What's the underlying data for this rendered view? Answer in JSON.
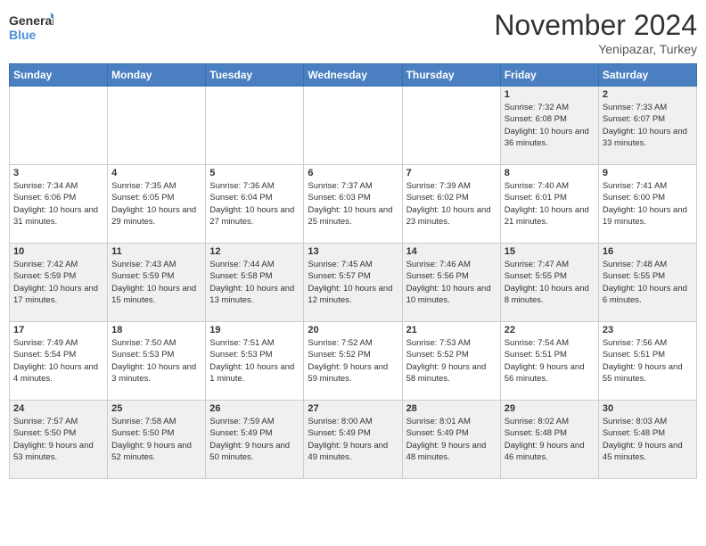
{
  "header": {
    "logo_line1": "General",
    "logo_line2": "Blue",
    "month": "November 2024",
    "location": "Yenipazar, Turkey"
  },
  "weekdays": [
    "Sunday",
    "Monday",
    "Tuesday",
    "Wednesday",
    "Thursday",
    "Friday",
    "Saturday"
  ],
  "weeks": [
    [
      {
        "day": "",
        "text": ""
      },
      {
        "day": "",
        "text": ""
      },
      {
        "day": "",
        "text": ""
      },
      {
        "day": "",
        "text": ""
      },
      {
        "day": "",
        "text": ""
      },
      {
        "day": "1",
        "text": "Sunrise: 7:32 AM\nSunset: 6:08 PM\nDaylight: 10 hours and 36 minutes."
      },
      {
        "day": "2",
        "text": "Sunrise: 7:33 AM\nSunset: 6:07 PM\nDaylight: 10 hours and 33 minutes."
      }
    ],
    [
      {
        "day": "3",
        "text": "Sunrise: 7:34 AM\nSunset: 6:06 PM\nDaylight: 10 hours and 31 minutes."
      },
      {
        "day": "4",
        "text": "Sunrise: 7:35 AM\nSunset: 6:05 PM\nDaylight: 10 hours and 29 minutes."
      },
      {
        "day": "5",
        "text": "Sunrise: 7:36 AM\nSunset: 6:04 PM\nDaylight: 10 hours and 27 minutes."
      },
      {
        "day": "6",
        "text": "Sunrise: 7:37 AM\nSunset: 6:03 PM\nDaylight: 10 hours and 25 minutes."
      },
      {
        "day": "7",
        "text": "Sunrise: 7:39 AM\nSunset: 6:02 PM\nDaylight: 10 hours and 23 minutes."
      },
      {
        "day": "8",
        "text": "Sunrise: 7:40 AM\nSunset: 6:01 PM\nDaylight: 10 hours and 21 minutes."
      },
      {
        "day": "9",
        "text": "Sunrise: 7:41 AM\nSunset: 6:00 PM\nDaylight: 10 hours and 19 minutes."
      }
    ],
    [
      {
        "day": "10",
        "text": "Sunrise: 7:42 AM\nSunset: 5:59 PM\nDaylight: 10 hours and 17 minutes."
      },
      {
        "day": "11",
        "text": "Sunrise: 7:43 AM\nSunset: 5:59 PM\nDaylight: 10 hours and 15 minutes."
      },
      {
        "day": "12",
        "text": "Sunrise: 7:44 AM\nSunset: 5:58 PM\nDaylight: 10 hours and 13 minutes."
      },
      {
        "day": "13",
        "text": "Sunrise: 7:45 AM\nSunset: 5:57 PM\nDaylight: 10 hours and 12 minutes."
      },
      {
        "day": "14",
        "text": "Sunrise: 7:46 AM\nSunset: 5:56 PM\nDaylight: 10 hours and 10 minutes."
      },
      {
        "day": "15",
        "text": "Sunrise: 7:47 AM\nSunset: 5:55 PM\nDaylight: 10 hours and 8 minutes."
      },
      {
        "day": "16",
        "text": "Sunrise: 7:48 AM\nSunset: 5:55 PM\nDaylight: 10 hours and 6 minutes."
      }
    ],
    [
      {
        "day": "17",
        "text": "Sunrise: 7:49 AM\nSunset: 5:54 PM\nDaylight: 10 hours and 4 minutes."
      },
      {
        "day": "18",
        "text": "Sunrise: 7:50 AM\nSunset: 5:53 PM\nDaylight: 10 hours and 3 minutes."
      },
      {
        "day": "19",
        "text": "Sunrise: 7:51 AM\nSunset: 5:53 PM\nDaylight: 10 hours and 1 minute."
      },
      {
        "day": "20",
        "text": "Sunrise: 7:52 AM\nSunset: 5:52 PM\nDaylight: 9 hours and 59 minutes."
      },
      {
        "day": "21",
        "text": "Sunrise: 7:53 AM\nSunset: 5:52 PM\nDaylight: 9 hours and 58 minutes."
      },
      {
        "day": "22",
        "text": "Sunrise: 7:54 AM\nSunset: 5:51 PM\nDaylight: 9 hours and 56 minutes."
      },
      {
        "day": "23",
        "text": "Sunrise: 7:56 AM\nSunset: 5:51 PM\nDaylight: 9 hours and 55 minutes."
      }
    ],
    [
      {
        "day": "24",
        "text": "Sunrise: 7:57 AM\nSunset: 5:50 PM\nDaylight: 9 hours and 53 minutes."
      },
      {
        "day": "25",
        "text": "Sunrise: 7:58 AM\nSunset: 5:50 PM\nDaylight: 9 hours and 52 minutes."
      },
      {
        "day": "26",
        "text": "Sunrise: 7:59 AM\nSunset: 5:49 PM\nDaylight: 9 hours and 50 minutes."
      },
      {
        "day": "27",
        "text": "Sunrise: 8:00 AM\nSunset: 5:49 PM\nDaylight: 9 hours and 49 minutes."
      },
      {
        "day": "28",
        "text": "Sunrise: 8:01 AM\nSunset: 5:49 PM\nDaylight: 9 hours and 48 minutes."
      },
      {
        "day": "29",
        "text": "Sunrise: 8:02 AM\nSunset: 5:48 PM\nDaylight: 9 hours and 46 minutes."
      },
      {
        "day": "30",
        "text": "Sunrise: 8:03 AM\nSunset: 5:48 PM\nDaylight: 9 hours and 45 minutes."
      }
    ]
  ]
}
